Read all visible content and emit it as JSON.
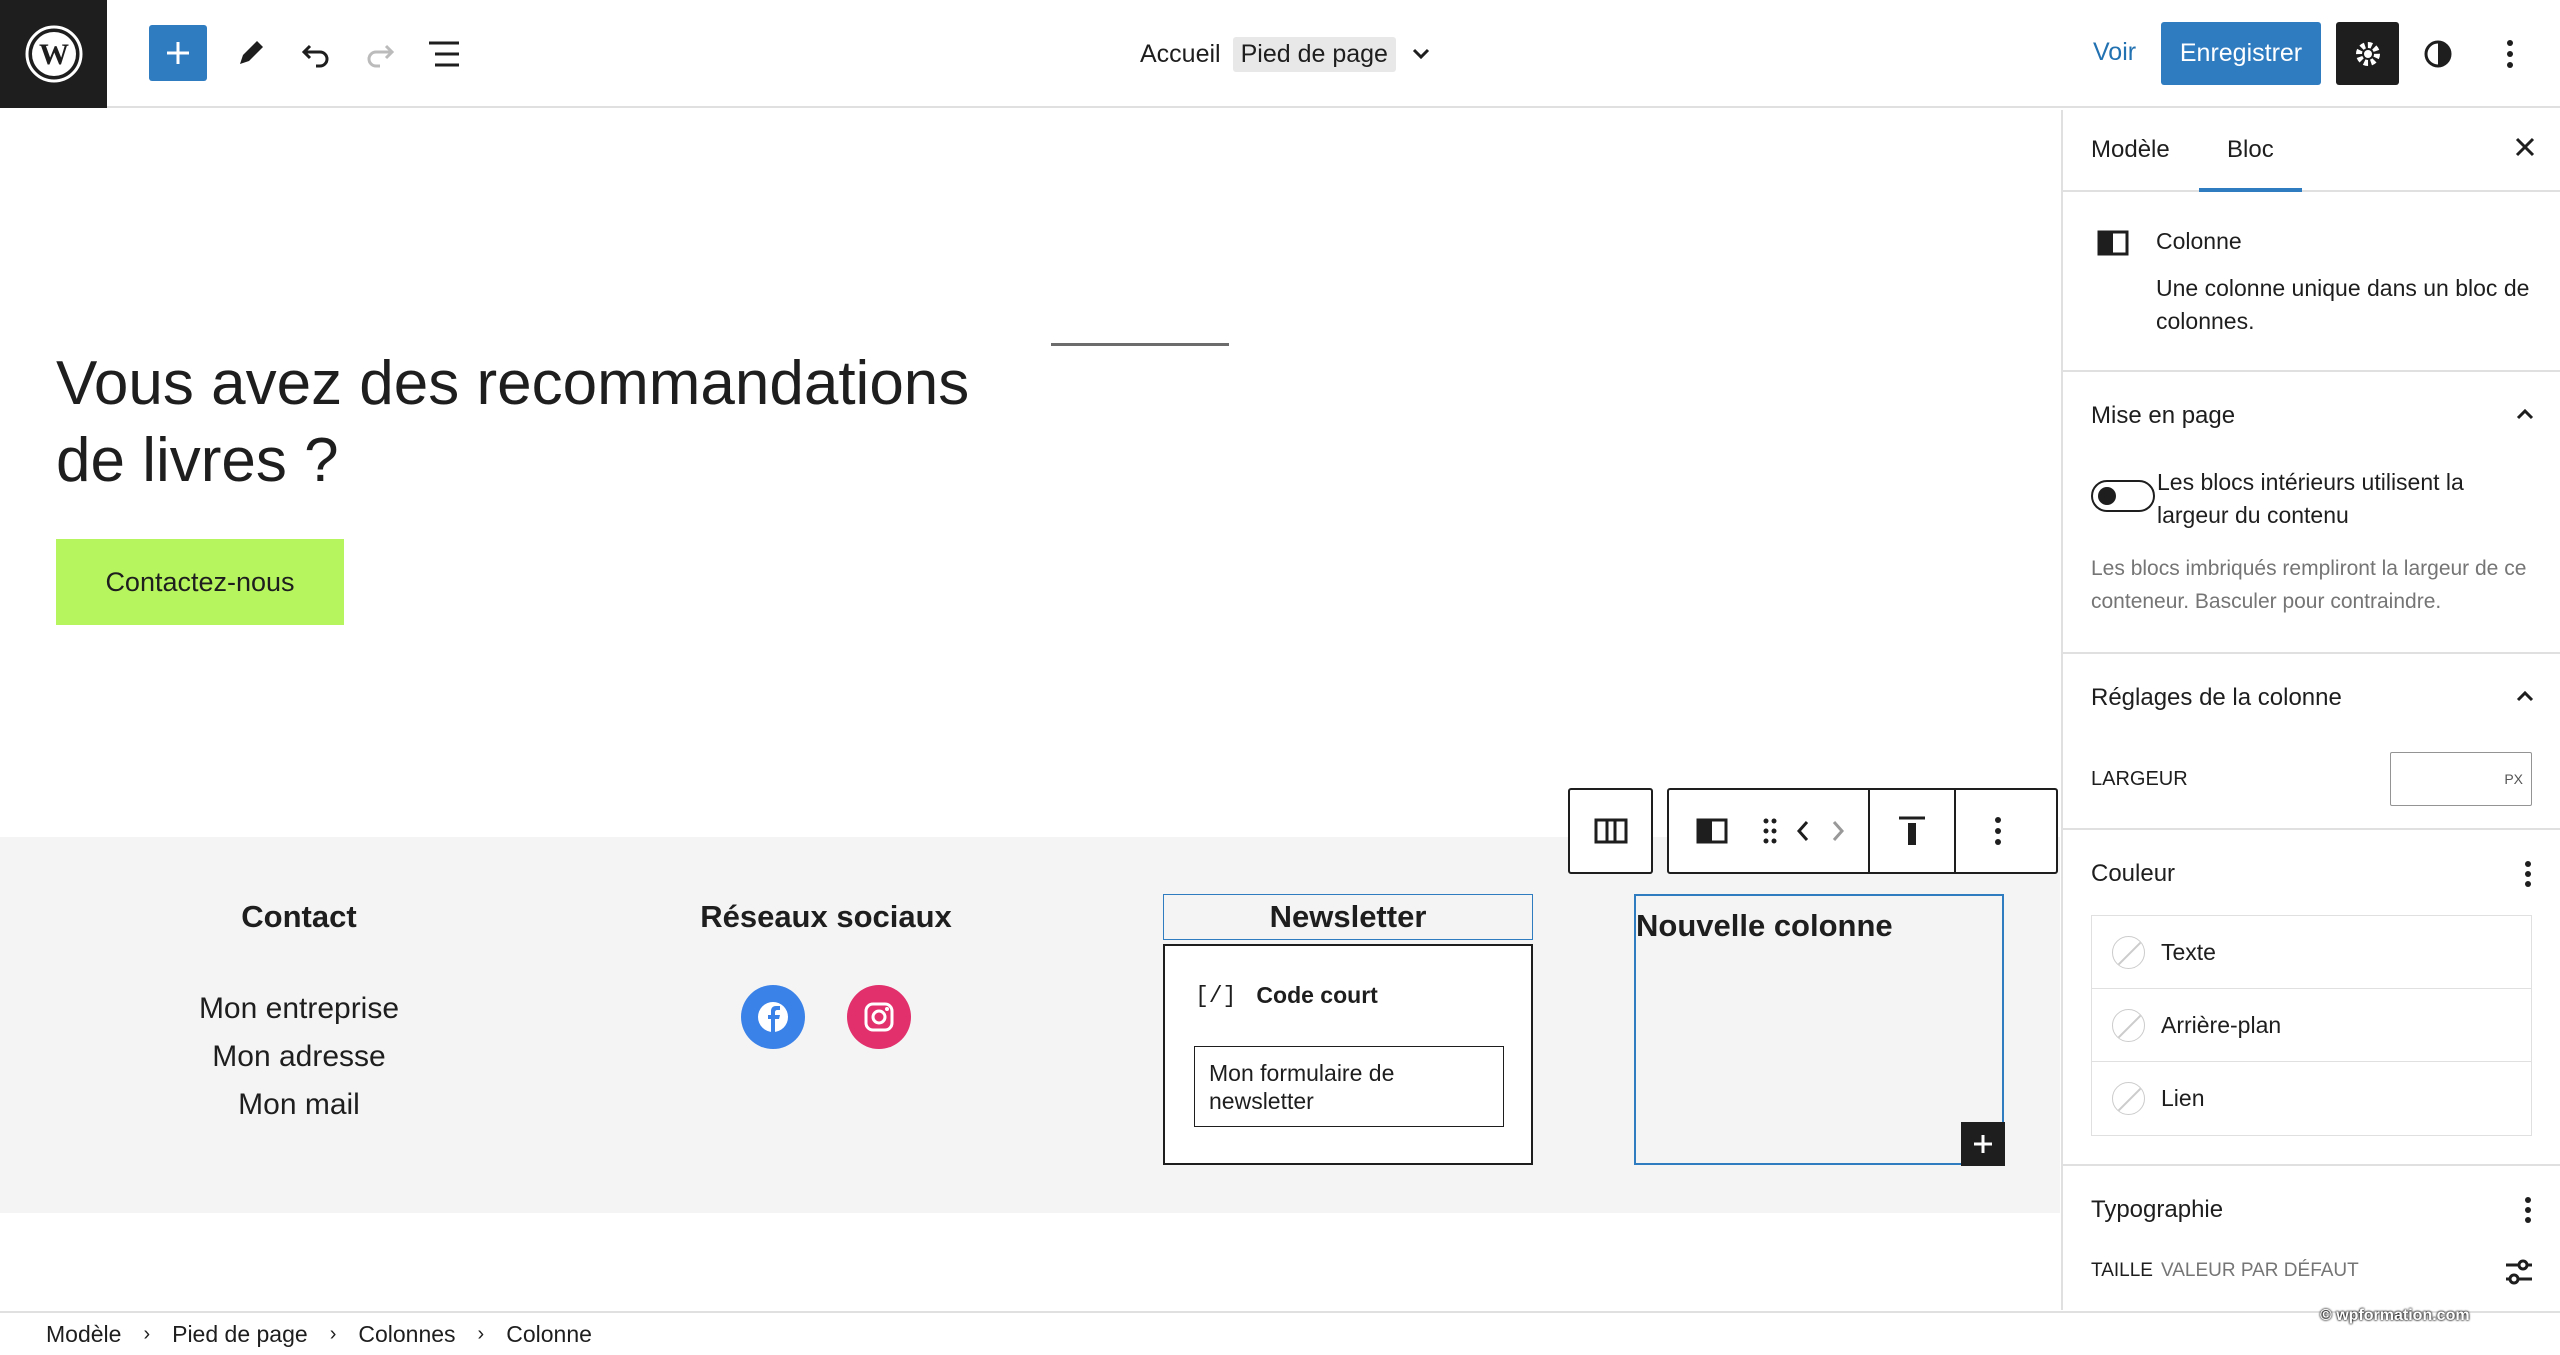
{
  "topbar": {
    "doc_home": "Accueil",
    "doc_part": "Pied de page",
    "voir": "Voir",
    "save": "Enregistrer"
  },
  "canvas": {
    "heading": "Vous avez des recommandations de livres ?",
    "contact_button": "Contactez-nous",
    "footer": {
      "col1_title": "Contact",
      "col1_lines": [
        "Mon entreprise",
        "Mon adresse",
        "Mon mail"
      ],
      "col2_title": "Réseaux sociaux",
      "col3_title": "Newsletter",
      "shortcode_icon": "[/]",
      "shortcode_label": "Code court",
      "shortcode_value": "Mon formulaire de newsletter",
      "col4_title": "Nouvelle colonne"
    }
  },
  "sidebar": {
    "tab_modele": "Modèle",
    "tab_bloc": "Bloc",
    "block_name": "Colonne",
    "block_desc": "Une colonne unique dans un bloc de colonnes.",
    "layout_title": "Mise en page",
    "toggle_label": "Les blocs intérieurs utilisent la largeur du contenu",
    "toggle_help": "Les blocs imbriqués rempliront la largeur de ce conteneur. Basculer pour contraindre.",
    "column_settings_title": "Réglages de la colonne",
    "width_label": "LARGEUR",
    "width_unit": "PX",
    "color_title": "Couleur",
    "colors": [
      "Texte",
      "Arrière-plan",
      "Lien"
    ],
    "typo_title": "Typographie",
    "size_label": "TAILLE",
    "size_value": "VALEUR PAR DÉFAUT"
  },
  "breadcrumb": [
    "Modèle",
    "Pied de page",
    "Colonnes",
    "Colonne"
  ],
  "watermark": "© wpformation.com",
  "colors": {
    "accent": "#2f7cc1",
    "button_green": "#b7f55e",
    "facebook": "#3b82e8",
    "instagram": "#e1306c"
  }
}
